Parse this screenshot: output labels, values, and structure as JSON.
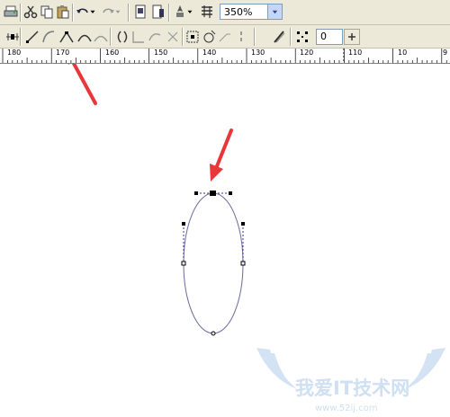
{
  "toolbar": {
    "zoom_value": "350%",
    "nudge_value": "0"
  },
  "ruler": {
    "labels": [
      "180",
      "170",
      "160",
      "150",
      "140",
      "130",
      "120",
      "110",
      "10",
      "9"
    ]
  },
  "watermark": {
    "title": "我爱IT技术网",
    "url": "www.52ij.com"
  },
  "colors": {
    "toolbar_bg": "#ece9d8",
    "arrow": "#e8373a",
    "curve": "#6a6a9a",
    "watermark": "#cfe0f3"
  },
  "icons": [
    "print-icon",
    "cut-icon",
    "copy-icon",
    "paste-icon",
    "undo-icon",
    "redo-icon",
    "import-icon",
    "export-icon",
    "launcher-icon",
    "zoom-icon",
    "chevron-down-icon",
    "add-node-icon",
    "delete-node-icon",
    "join-nodes-icon",
    "break-curve-icon",
    "to-line-icon",
    "to-curve-icon",
    "cusp-node-icon",
    "smooth-node-icon",
    "symmetric-node-icon",
    "reverse-direction-icon",
    "extend-curve-icon",
    "extract-subpath-icon",
    "stretch-node-icon",
    "rotate-node-icon",
    "align-nodes-icon",
    "elastic-mode-icon",
    "select-all-nodes-icon",
    "plus-icon"
  ]
}
